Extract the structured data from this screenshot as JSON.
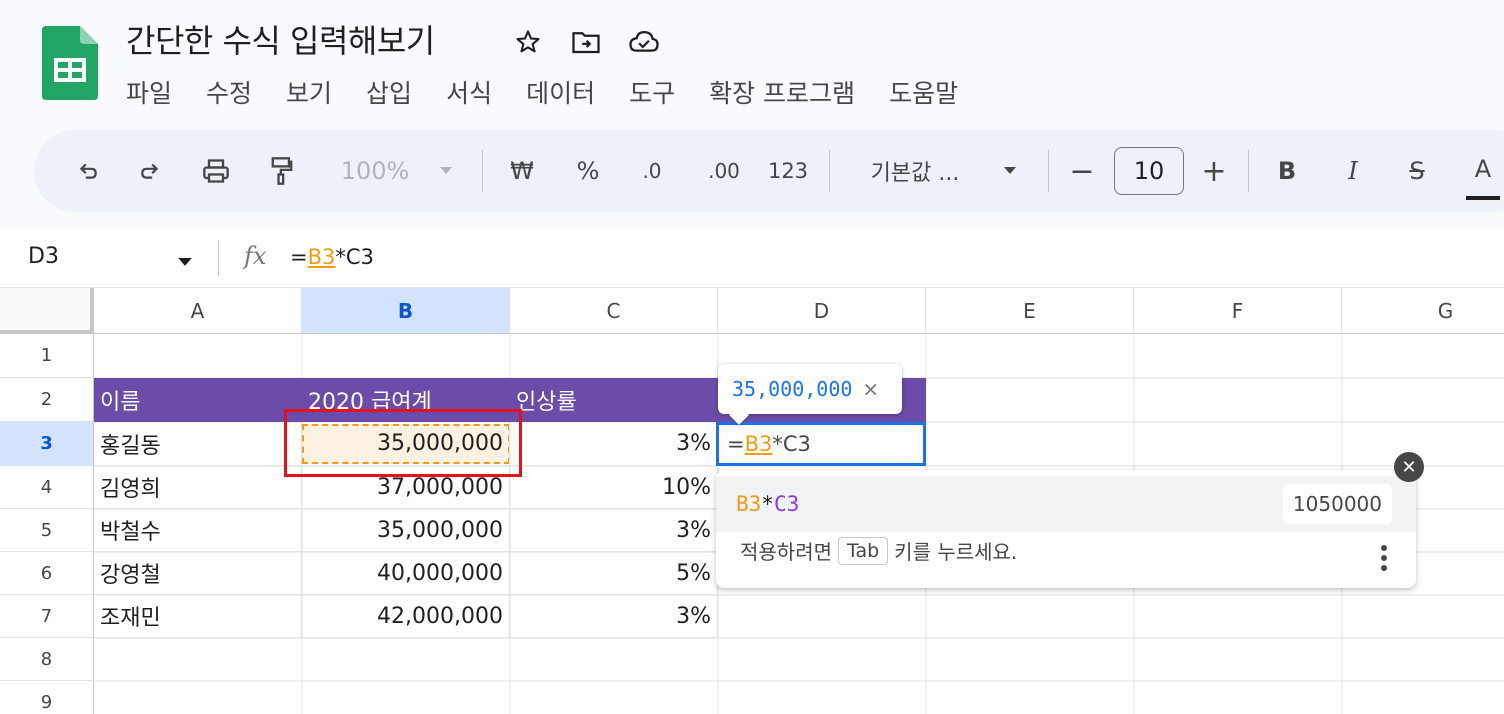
{
  "doc": {
    "title": "간단한 수식 입력해보기"
  },
  "menu": [
    "파일",
    "수정",
    "보기",
    "삽입",
    "서식",
    "데이터",
    "도구",
    "확장 프로그램",
    "도움말"
  ],
  "toolbar": {
    "zoom": "100%",
    "currency": "₩",
    "percent": "%",
    "dec_decrease": ".0",
    "dec_increase": ".00",
    "number_format": "123",
    "font": "기본값 ...",
    "font_size": "10",
    "minus": "−",
    "plus": "+",
    "bold": "B",
    "italic": "I",
    "strike": "S",
    "text_color": "A"
  },
  "formula_bar": {
    "name_box": "D3",
    "fx": "fx",
    "formula_prefix": "=",
    "formula_ref": "B3",
    "formula_rest": "*C3"
  },
  "columns": [
    "A",
    "B",
    "C",
    "D",
    "E",
    "F",
    "G"
  ],
  "rows": [
    "1",
    "2",
    "3",
    "4",
    "5",
    "6",
    "7",
    "8",
    "9"
  ],
  "table": {
    "headers": [
      "이름",
      "2020 급여계",
      "인상률"
    ],
    "data": [
      {
        "name": "홍길동",
        "salary": "35,000,000",
        "rate": "3%"
      },
      {
        "name": "김영희",
        "salary": "37,000,000",
        "rate": "10%"
      },
      {
        "name": "박철수",
        "salary": "35,000,000",
        "rate": "3%"
      },
      {
        "name": "강영철",
        "salary": "40,000,000",
        "rate": "5%"
      },
      {
        "name": "조재민",
        "salary": "42,000,000",
        "rate": "3%"
      }
    ]
  },
  "edit_cell": {
    "prefix": "=",
    "ref": "B3",
    "rest": "*C3"
  },
  "tooltip": {
    "value": "35,000,000",
    "close": "×"
  },
  "suggestion": {
    "ref1": "B3",
    "op": "*",
    "ref2": "C3",
    "result": "1050000",
    "hint_before": "적용하려면",
    "hint_key": "Tab",
    "hint_after": "키를 누르세요."
  },
  "colors": {
    "header_purple": "#6b4ca8",
    "ref_orange": "#f09a15",
    "ref_purple": "#9334e6",
    "selection_blue": "#1a73e8",
    "annotation_red": "#e0141e"
  }
}
